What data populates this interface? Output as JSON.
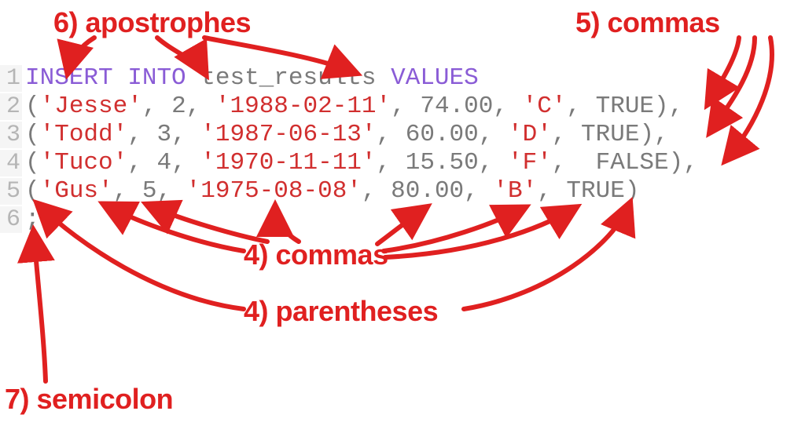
{
  "annotations": {
    "apostrophes": "6) apostrophes",
    "commas_top": "5) commas",
    "commas_mid": "4) commas",
    "parentheses": "4) parentheses",
    "semicolon": "7) semicolon"
  },
  "code": {
    "line_numbers": [
      "1",
      "2",
      "3",
      "4",
      "5",
      "6"
    ],
    "sql": [
      "INSERT INTO test_results VALUES",
      "('Jesse', 2, '1988-02-11', 74.00, 'C', TRUE),",
      "('Todd', 3, '1987-06-13', 60.00, 'D', TRUE),",
      "('Tuco', 4, '1970-11-11', 15.50, 'F',  FALSE),",
      "('Gus', 5, '1975-08-08', 80.00, 'B', TRUE)",
      ";"
    ],
    "tokens": {
      "keywords": [
        "INSERT",
        "INTO",
        "VALUES"
      ],
      "identifier": "test_results",
      "rows": [
        {
          "name": "'Jesse'",
          "n": "2",
          "date": "'1988-02-11'",
          "val": "74.00",
          "grade": "'C'",
          "bool": "TRUE",
          "trailing_comma": true
        },
        {
          "name": "'Todd'",
          "n": "3",
          "date": "'1987-06-13'",
          "val": "60.00",
          "grade": "'D'",
          "bool": "TRUE",
          "trailing_comma": true
        },
        {
          "name": "'Tuco'",
          "n": "4",
          "date": "'1970-11-11'",
          "val": "15.50",
          "grade": "'F'",
          "bool": "FALSE",
          "extra_space": true,
          "trailing_comma": true
        },
        {
          "name": "'Gus'",
          "n": "5",
          "date": "'1975-08-08'",
          "val": "80.00",
          "grade": "'B'",
          "bool": "TRUE",
          "trailing_comma": false
        }
      ],
      "terminator": ";"
    }
  },
  "colors": {
    "annotation": "#e02020",
    "keyword": "#8a5cd6",
    "string": "#d12f2f",
    "default": "#7a7a7a",
    "lineno": "#b5b5b5",
    "gutter_bg": "#f5f5f5"
  }
}
